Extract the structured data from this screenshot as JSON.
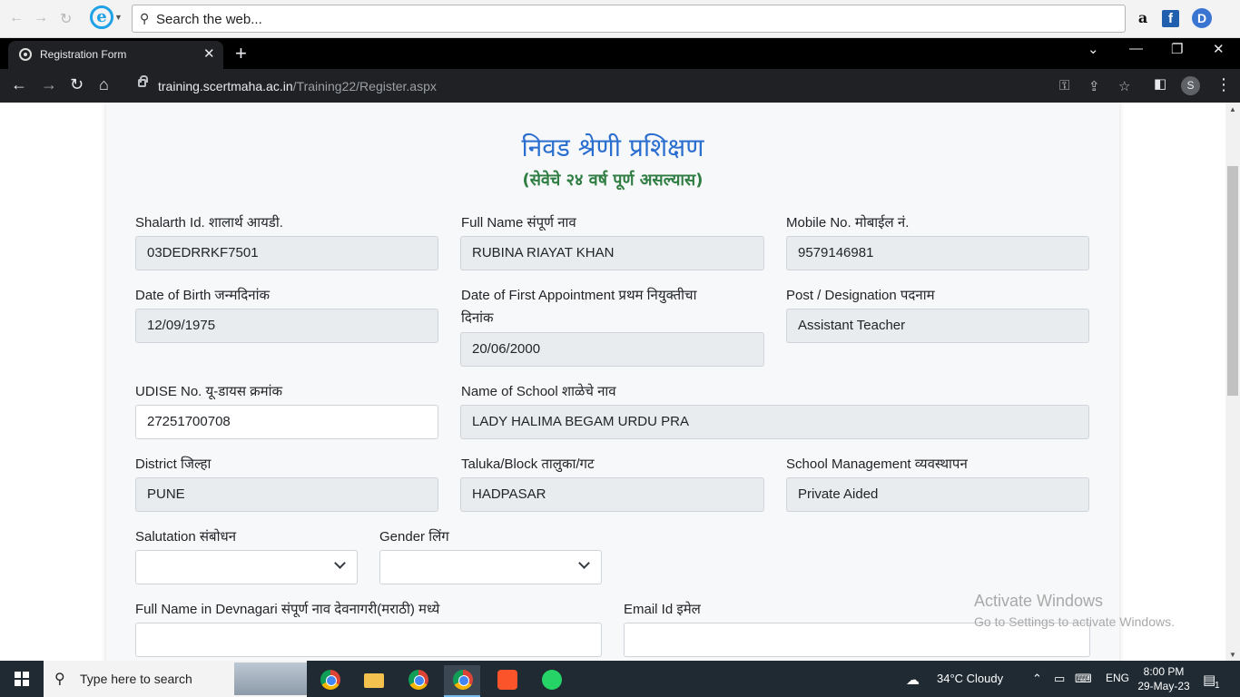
{
  "ie_bar": {
    "search_placeholder": "Search the web...",
    "extensions": [
      "amazon-icon",
      "facebook-icon",
      "d-extension-icon"
    ],
    "amazon_glyph": "a",
    "facebook_glyph": "f",
    "d_glyph": "D"
  },
  "tab": {
    "title": "Registration Form"
  },
  "toolbar": {
    "url_host": "training.scertmaha.ac.in",
    "url_path": "/Training22/Register.aspx",
    "profile_initial": "S"
  },
  "page": {
    "heading": "निवड श्रेणी प्रशिक्षण",
    "subheading": "(सेवेचे २४ वर्ष पूर्ण असल्यास)",
    "fields": {
      "shalarth": {
        "label": "Shalarth Id. शालार्थ आयडी.",
        "value": "03DEDRRKF7501"
      },
      "full_name": {
        "label": "Full Name संपूर्ण नाव",
        "value": "RUBINA RIAYAT KHAN"
      },
      "mobile": {
        "label": "Mobile No. मोबाईल नं.",
        "value": "9579146981"
      },
      "dob": {
        "label": "Date of Birth जन्मदिनांक",
        "value": "12/09/1975"
      },
      "first_appointment": {
        "label_line1": "Date of First Appointment प्रथम नियुक्तीचा",
        "label_line2": "दिनांक",
        "value": "20/06/2000"
      },
      "designation": {
        "label": "Post / Designation पदनाम",
        "value": "Assistant Teacher"
      },
      "udise": {
        "label": "UDISE No. यू-डायस क्रमांक",
        "value": "27251700708"
      },
      "school_name": {
        "label": "Name of School शाळेचे नाव",
        "value": "LADY HALIMA BEGAM URDU PRA"
      },
      "district": {
        "label": "District जिल्हा",
        "value": "PUNE"
      },
      "taluka": {
        "label": "Taluka/Block तालुका/गट",
        "value": "HADPASAR"
      },
      "management": {
        "label": "School Management व्यवस्थापन",
        "value": "Private Aided"
      },
      "salutation": {
        "label": "Salutation संबोधन",
        "value": ""
      },
      "gender": {
        "label": "Gender लिंग",
        "value": ""
      },
      "devnagari_name": {
        "label": "Full Name in Devnagari संपूर्ण नाव देवनागरी(मराठी) मध्ये",
        "value": ""
      },
      "email": {
        "label": "Email Id इमेल",
        "value": ""
      }
    }
  },
  "watermark": {
    "line1": "Activate Windows",
    "line2": "Go to Settings to activate Windows."
  },
  "taskbar": {
    "search_text": "Type here to search",
    "weather": "34°C  Cloudy",
    "language": "ENG",
    "time": "8:00 PM",
    "date": "29-May-23",
    "notification_count": "1"
  }
}
